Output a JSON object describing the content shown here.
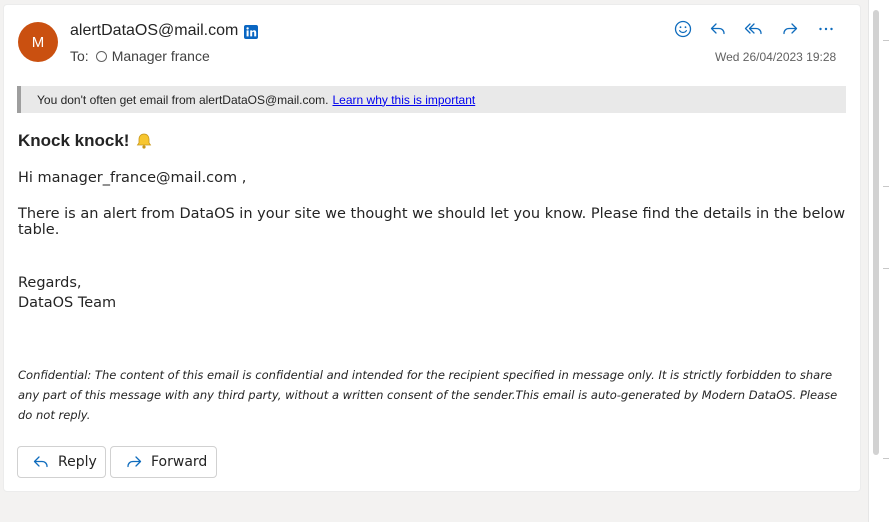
{
  "header": {
    "avatar_initial": "M",
    "sender": "alertDataOS@mail.com",
    "to_label": "To:",
    "recipient": "Manager france",
    "date": "Wed 26/04/2023 19:28"
  },
  "toolbar": {
    "icons": [
      "emoji-icon",
      "reply-icon",
      "reply-all-icon",
      "forward-icon",
      "more-icon"
    ]
  },
  "banner": {
    "text": "You don't often get email from alertDataOS@mail.com.",
    "link": "Learn why this is important"
  },
  "body": {
    "title": "Knock knock!",
    "greeting": "Hi manager_france@mail.com ,",
    "message": "There is an alert from DataOS in your site we thought we should let you know. Please find the details in the below table.",
    "regards": "Regards,",
    "team": "DataOS Team",
    "confidential": "Confidential: The content of this email is confidential and intended for the recipient specified in message only. It is strictly forbidden to share any part of this message with any third party, without a written consent of the sender.This email is auto-generated by Modern DataOS. Please do not reply."
  },
  "actions": {
    "reply": "Reply",
    "forward": "Forward"
  },
  "colors": {
    "avatar": "#ca5010",
    "accent": "#0f6cbd",
    "linkedin": "#0a66c2",
    "bell": "#f7c62f"
  }
}
